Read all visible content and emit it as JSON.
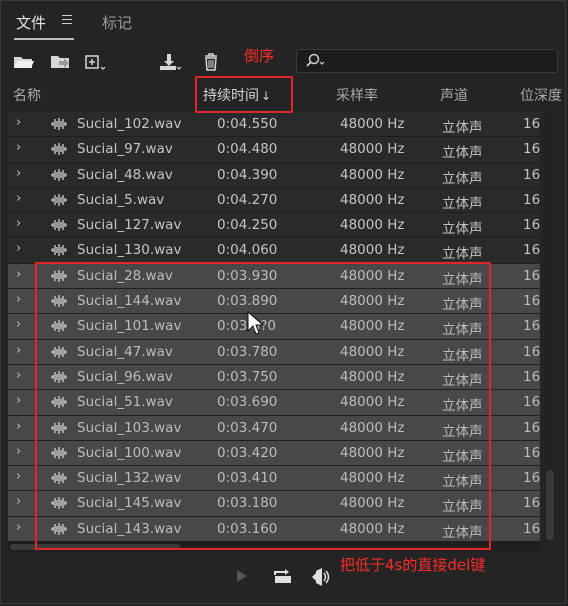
{
  "tabs": {
    "files_label": "文件",
    "markers_label": "标记"
  },
  "columns": {
    "name": "名称",
    "duration": "持续时间",
    "sort_indicator": "↓",
    "sample_rate": "采样率",
    "channels": "声道",
    "bit_depth": "位深度"
  },
  "rows": [
    {
      "name": "Sucial_102.wav",
      "duration": "0:04.550",
      "sample_rate": "48000 Hz",
      "channels": "立体声",
      "bit_depth": "16",
      "selected": false
    },
    {
      "name": "Sucial_97.wav",
      "duration": "0:04.480",
      "sample_rate": "48000 Hz",
      "channels": "立体声",
      "bit_depth": "16",
      "selected": false
    },
    {
      "name": "Sucial_48.wav",
      "duration": "0:04.390",
      "sample_rate": "48000 Hz",
      "channels": "立体声",
      "bit_depth": "16",
      "selected": false
    },
    {
      "name": "Sucial_5.wav",
      "duration": "0:04.270",
      "sample_rate": "48000 Hz",
      "channels": "立体声",
      "bit_depth": "16",
      "selected": false
    },
    {
      "name": "Sucial_127.wav",
      "duration": "0:04.250",
      "sample_rate": "48000 Hz",
      "channels": "立体声",
      "bit_depth": "16",
      "selected": false
    },
    {
      "name": "Sucial_130.wav",
      "duration": "0:04.060",
      "sample_rate": "48000 Hz",
      "channels": "立体声",
      "bit_depth": "16",
      "selected": false
    },
    {
      "name": "Sucial_28.wav",
      "duration": "0:03.930",
      "sample_rate": "48000 Hz",
      "channels": "立体声",
      "bit_depth": "16",
      "selected": true
    },
    {
      "name": "Sucial_144.wav",
      "duration": "0:03.890",
      "sample_rate": "48000 Hz",
      "channels": "立体声",
      "bit_depth": "16",
      "selected": true
    },
    {
      "name": "Sucial_101.wav",
      "duration": "0:03.8?0",
      "sample_rate": "48000 Hz",
      "channels": "立体声",
      "bit_depth": "16",
      "selected": true
    },
    {
      "name": "Sucial_47.wav",
      "duration": "0:03.780",
      "sample_rate": "48000 Hz",
      "channels": "立体声",
      "bit_depth": "16",
      "selected": true
    },
    {
      "name": "Sucial_96.wav",
      "duration": "0:03.750",
      "sample_rate": "48000 Hz",
      "channels": "立体声",
      "bit_depth": "16",
      "selected": true
    },
    {
      "name": "Sucial_51.wav",
      "duration": "0:03.690",
      "sample_rate": "48000 Hz",
      "channels": "立体声",
      "bit_depth": "16",
      "selected": true
    },
    {
      "name": "Sucial_103.wav",
      "duration": "0:03.470",
      "sample_rate": "48000 Hz",
      "channels": "立体声",
      "bit_depth": "16",
      "selected": true
    },
    {
      "name": "Sucial_100.wav",
      "duration": "0:03.420",
      "sample_rate": "48000 Hz",
      "channels": "立体声",
      "bit_depth": "16",
      "selected": true
    },
    {
      "name": "Sucial_132.wav",
      "duration": "0:03.410",
      "sample_rate": "48000 Hz",
      "channels": "立体声",
      "bit_depth": "16",
      "selected": true
    },
    {
      "name": "Sucial_145.wav",
      "duration": "0:03.180",
      "sample_rate": "48000 Hz",
      "channels": "立体声",
      "bit_depth": "16",
      "selected": true
    },
    {
      "name": "Sucial_143.wav",
      "duration": "0:03.160",
      "sample_rate": "48000 Hz",
      "channels": "立体声",
      "bit_depth": "16",
      "selected": true
    }
  ],
  "annotations": {
    "sort_note": "倒序",
    "delete_note": "把低于4s的直接del键"
  },
  "colors": {
    "annotation_red": "#e0262b",
    "selected_row": "#484848",
    "background": "#242424"
  }
}
